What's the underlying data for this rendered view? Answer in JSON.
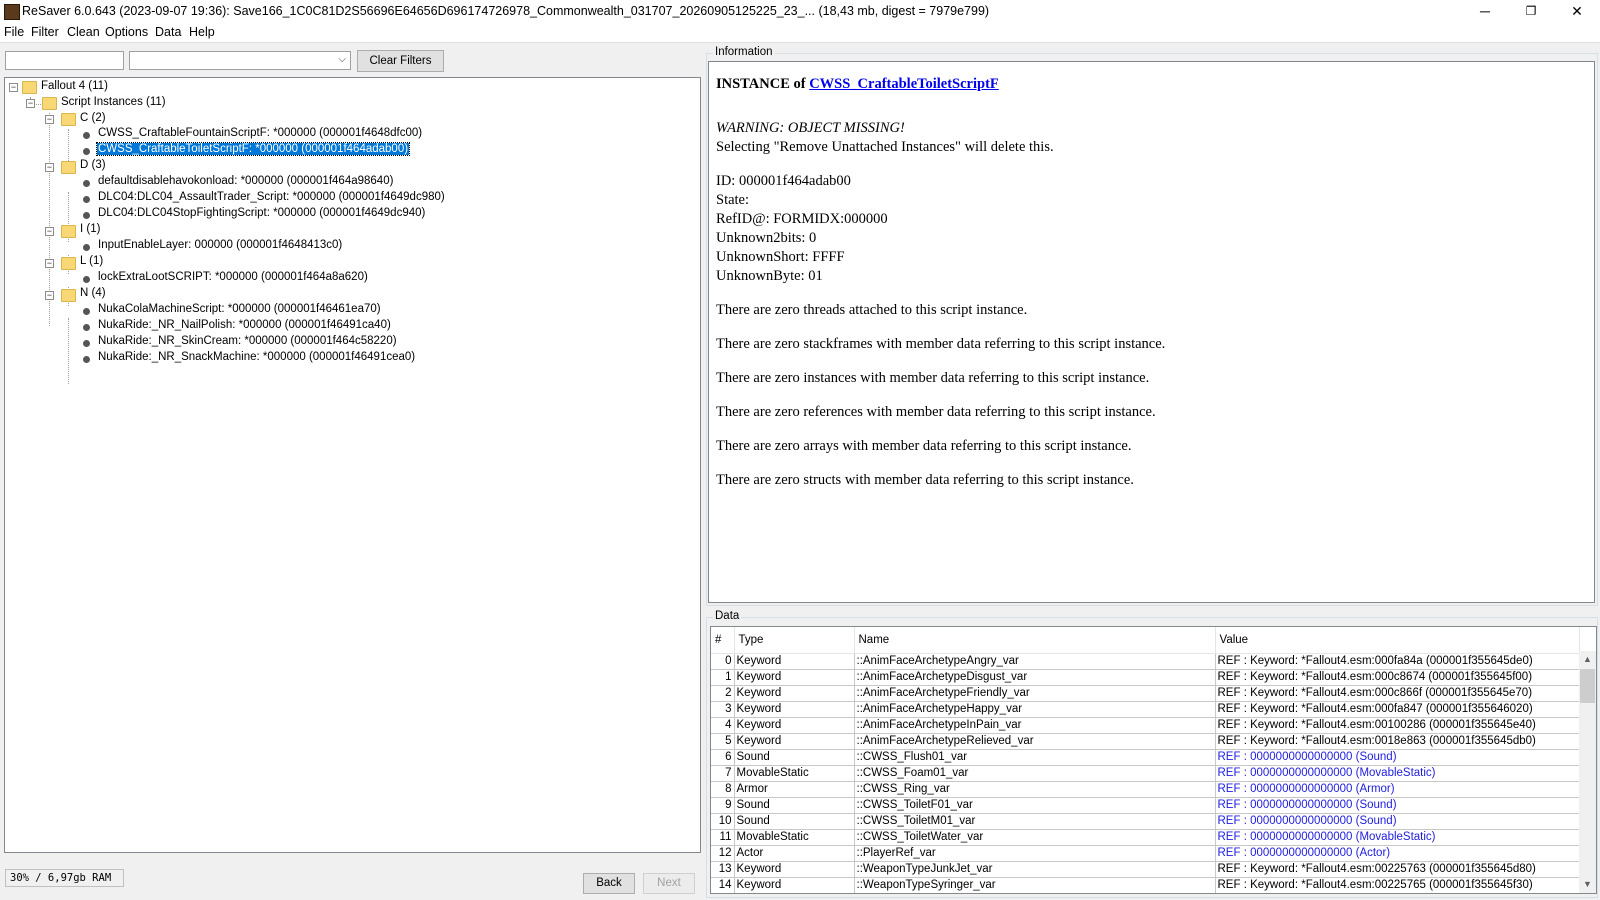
{
  "window": {
    "title": "ReSaver 6.0.643 (2023-09-07 19:36): Save166_1C0C81D2S56696E64656D696174726978_Commonwealth_031707_20260905125225_23_... (18,43 mb, digest = 7979e799)",
    "minimize": "─",
    "maximize": "❐",
    "close": "✕"
  },
  "menu": [
    "File",
    "Filter",
    "Clean",
    "Options",
    "Data",
    "Help"
  ],
  "filter": {
    "text_value": "",
    "select_value": "",
    "clear_label": "Clear Filters"
  },
  "tree": {
    "root": "Fallout 4 (11)",
    "script_instances": "Script Instances (11)",
    "groups": [
      {
        "label": "C (2)",
        "items": [
          "CWSS_CraftableFountainScriptF: *000000 (000001f4648dfc00)",
          "CWSS_CraftableToiletScriptF: *000000 (000001f464adab00)"
        ]
      },
      {
        "label": "D (3)",
        "items": [
          "defaultdisablehavokonload: *000000 (000001f464a98640)",
          "DLC04:DLC04_AssaultTrader_Script: *000000 (000001f4649dc980)",
          "DLC04:DLC04StopFightingScript: *000000 (000001f4649dc940)"
        ]
      },
      {
        "label": "I (1)",
        "items": [
          "InputEnableLayer: 000000 (000001f4648413c0)"
        ]
      },
      {
        "label": "L (1)",
        "items": [
          "lockExtraLootSCRIPT: *000000 (000001f464a8a620)"
        ]
      },
      {
        "label": "N (4)",
        "items": [
          "NukaColaMachineScript: *000000 (000001f46461ea70)",
          "NukaRide:_NR_NailPolish: *000000 (000001f46491ca40)",
          "NukaRide:_NR_SkinCream: *000000 (000001f464c58220)",
          "NukaRide:_NR_SnackMachine: *000000 (000001f46491cea0)"
        ]
      }
    ]
  },
  "status": {
    "memory": "30% / 6,97gb RAM",
    "back_label": "Back",
    "next_label": "Next"
  },
  "info": {
    "group_title": "Information",
    "instance_prefix": "INSTANCE of ",
    "instance_link": "CWSS_CraftableToiletScriptF",
    "warning": "WARNING: OBJECT MISSING!",
    "remove_note": "Selecting \"Remove Unattached Instances\" will delete this.",
    "fields": [
      "ID: 000001f464adab00",
      "State:",
      "RefID@: FORMIDX:000000",
      "Unknown2bits: 0",
      "UnknownShort: FFFF",
      "UnknownByte: 01"
    ],
    "notes": [
      "There are zero threads attached to this script instance.",
      "There are zero stackframes with member data referring to this script instance.",
      "There are zero instances with member data referring to this script instance.",
      "There are zero references with member data referring to this script instance.",
      "There are zero arrays with member data referring to this script instance.",
      "There are zero structs with member data referring to this script instance."
    ]
  },
  "data_table": {
    "group_title": "Data",
    "headers": [
      "#",
      "Type",
      "Name",
      "Value"
    ],
    "link_color": "#1d1de0",
    "rows": [
      {
        "n": "0",
        "type": "Keyword",
        "name": "::AnimFaceArchetypeAngry_var",
        "value": "REF : Keyword: *Fallout4.esm:000fa84a (000001f355645de0)",
        "blue": false
      },
      {
        "n": "1",
        "type": "Keyword",
        "name": "::AnimFaceArchetypeDisgust_var",
        "value": "REF : Keyword: *Fallout4.esm:000c8674 (000001f355645f00)",
        "blue": false
      },
      {
        "n": "2",
        "type": "Keyword",
        "name": "::AnimFaceArchetypeFriendly_var",
        "value": "REF : Keyword: *Fallout4.esm:000c866f (000001f355645e70)",
        "blue": false
      },
      {
        "n": "3",
        "type": "Keyword",
        "name": "::AnimFaceArchetypeHappy_var",
        "value": "REF : Keyword: *Fallout4.esm:000fa847 (000001f355646020)",
        "blue": false
      },
      {
        "n": "4",
        "type": "Keyword",
        "name": "::AnimFaceArchetypeInPain_var",
        "value": "REF : Keyword: *Fallout4.esm:00100286 (000001f355645e40)",
        "blue": false
      },
      {
        "n": "5",
        "type": "Keyword",
        "name": "::AnimFaceArchetypeRelieved_var",
        "value": "REF : Keyword: *Fallout4.esm:0018e863 (000001f355645db0)",
        "blue": false
      },
      {
        "n": "6",
        "type": "Sound",
        "name": "::CWSS_Flush01_var",
        "value": "REF : 0000000000000000 (Sound)",
        "blue": true
      },
      {
        "n": "7",
        "type": "MovableStatic",
        "name": "::CWSS_Foam01_var",
        "value": "REF : 0000000000000000 (MovableStatic)",
        "blue": true
      },
      {
        "n": "8",
        "type": "Armor",
        "name": "::CWSS_Ring_var",
        "value": "REF : 0000000000000000 (Armor)",
        "blue": true
      },
      {
        "n": "9",
        "type": "Sound",
        "name": "::CWSS_ToiletF01_var",
        "value": "REF : 0000000000000000 (Sound)",
        "blue": true
      },
      {
        "n": "10",
        "type": "Sound",
        "name": "::CWSS_ToiletM01_var",
        "value": "REF : 0000000000000000 (Sound)",
        "blue": true
      },
      {
        "n": "11",
        "type": "MovableStatic",
        "name": "::CWSS_ToiletWater_var",
        "value": "REF : 0000000000000000 (MovableStatic)",
        "blue": true
      },
      {
        "n": "12",
        "type": "Actor",
        "name": "::PlayerRef_var",
        "value": "REF : 0000000000000000 (Actor)",
        "blue": true
      },
      {
        "n": "13",
        "type": "Keyword",
        "name": "::WeaponTypeJunkJet_var",
        "value": "REF : Keyword: *Fallout4.esm:00225763 (000001f355645d80)",
        "blue": false
      },
      {
        "n": "14",
        "type": "Keyword",
        "name": "::WeaponTypeSyringer_var",
        "value": "REF : Keyword: *Fallout4.esm:00225765 (000001f355645f30)",
        "blue": false
      }
    ]
  }
}
